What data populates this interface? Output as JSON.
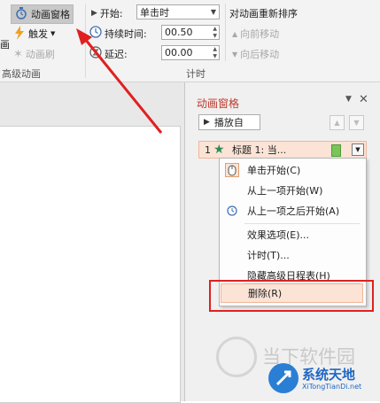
{
  "ribbon": {
    "left_partial": {
      "group_label": "高级动画",
      "cut_char": "画"
    },
    "adv_group": {
      "anim_pane_label": "动画窗格",
      "trigger_label": "触发",
      "anim_painter_label": "动画刷"
    },
    "timing": {
      "start_label": "开始:",
      "start_value": "单击时",
      "duration_label": "持续时间:",
      "duration_value": "00.50",
      "delay_label": "延迟:",
      "delay_value": "00.00",
      "group_label": "计时"
    },
    "reorder": {
      "title": "对动画重新排序",
      "move_earlier": "向前移动",
      "move_later": "向后移动"
    }
  },
  "pane": {
    "title": "动画窗格",
    "play_label": "播放自",
    "item": {
      "index": "1",
      "text": "标题 1: 当..."
    }
  },
  "context_menu": {
    "items": [
      {
        "label": "单击开始(C)"
      },
      {
        "label": "从上一项开始(W)"
      },
      {
        "label": "从上一项之后开始(A)"
      },
      {
        "label": "效果选项(E)..."
      },
      {
        "label": "计时(T)..."
      },
      {
        "label": "隐藏高级日程表(H)"
      },
      {
        "label": "删除(R)"
      }
    ]
  },
  "watermark": {
    "site_cn": "当下软件园",
    "brand": "系统天地",
    "url": "XiTongTianDi.net"
  },
  "colors": {
    "annotation": "#e02020",
    "pane_title": "#c0392b",
    "selected_item_bg": "#fbe3d6",
    "star": "#2e8b57"
  }
}
